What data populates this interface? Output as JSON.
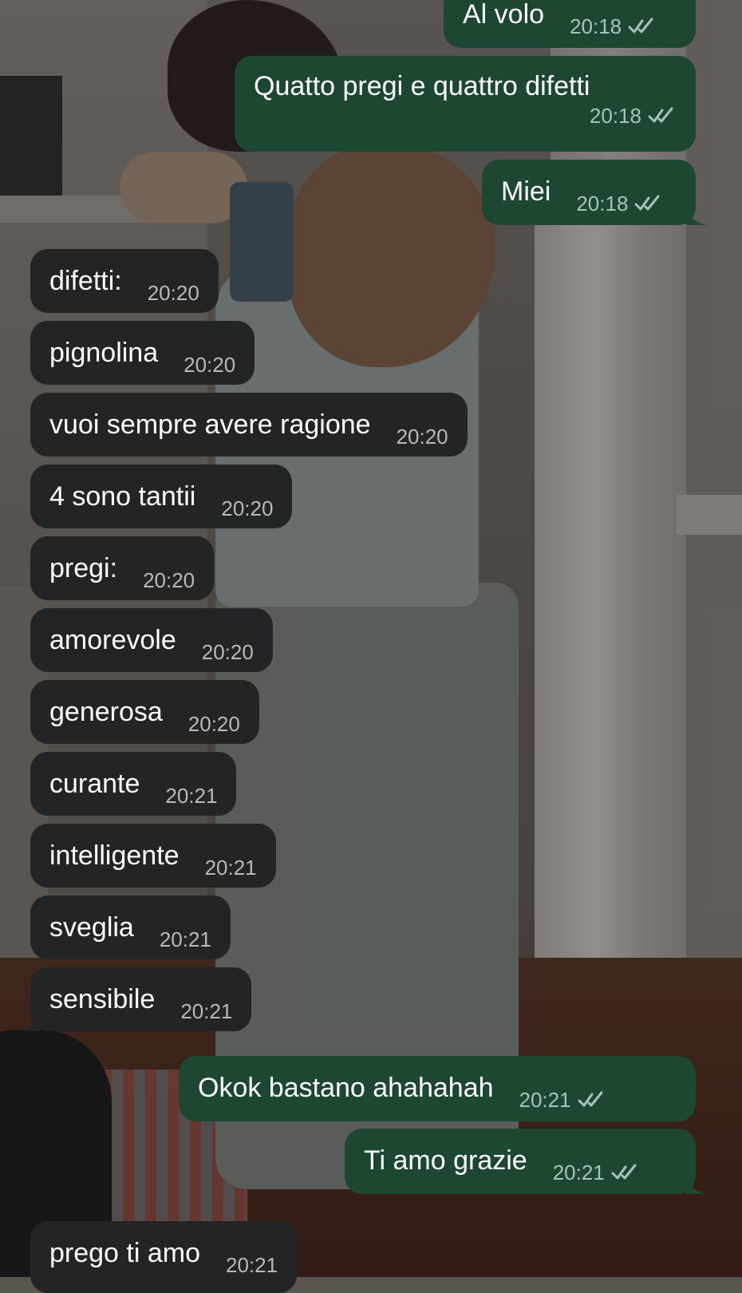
{
  "colors": {
    "outgoing_bubble": "#1e4732",
    "incoming_bubble": "#232426",
    "timestamp_incoming": "#b7b9bb",
    "timestamp_outgoing": "#a8c4b4",
    "read_ticks": "#a8c4b4"
  },
  "messages": [
    {
      "id": "m1",
      "direction": "out",
      "text": "Al volo",
      "time": "20:18",
      "status": "read"
    },
    {
      "id": "m2",
      "direction": "out",
      "text": "Quatto pregi e quattro difetti",
      "time": "20:18",
      "status": "read"
    },
    {
      "id": "m3",
      "direction": "out",
      "text": "Miei",
      "time": "20:18",
      "status": "read"
    },
    {
      "id": "m4",
      "direction": "in",
      "text": "difetti:",
      "time": "20:20"
    },
    {
      "id": "m5",
      "direction": "in",
      "text": "pignolina",
      "time": "20:20"
    },
    {
      "id": "m6",
      "direction": "in",
      "text": "vuoi sempre avere ragione",
      "time": "20:20"
    },
    {
      "id": "m7",
      "direction": "in",
      "text": "4 sono tantii",
      "time": "20:20"
    },
    {
      "id": "m8",
      "direction": "in",
      "text": "pregi:",
      "time": "20:20"
    },
    {
      "id": "m9",
      "direction": "in",
      "text": "amorevole",
      "time": "20:20"
    },
    {
      "id": "m10",
      "direction": "in",
      "text": "generosa",
      "time": "20:20"
    },
    {
      "id": "m11",
      "direction": "in",
      "text": "curante",
      "time": "20:21"
    },
    {
      "id": "m12",
      "direction": "in",
      "text": "intelligente",
      "time": "20:21"
    },
    {
      "id": "m13",
      "direction": "in",
      "text": "sveglia",
      "time": "20:21"
    },
    {
      "id": "m14",
      "direction": "in",
      "text": "sensibile",
      "time": "20:21"
    },
    {
      "id": "m15",
      "direction": "out",
      "text": "Okok bastano ahahahah",
      "time": "20:21",
      "status": "read"
    },
    {
      "id": "m16",
      "direction": "out",
      "text": "Ti amo grazie",
      "time": "20:21",
      "status": "read"
    },
    {
      "id": "m17",
      "direction": "in",
      "text": "prego ti amo",
      "time": "20:21"
    }
  ],
  "icons": {
    "read_receipt": "double-check-icon"
  }
}
